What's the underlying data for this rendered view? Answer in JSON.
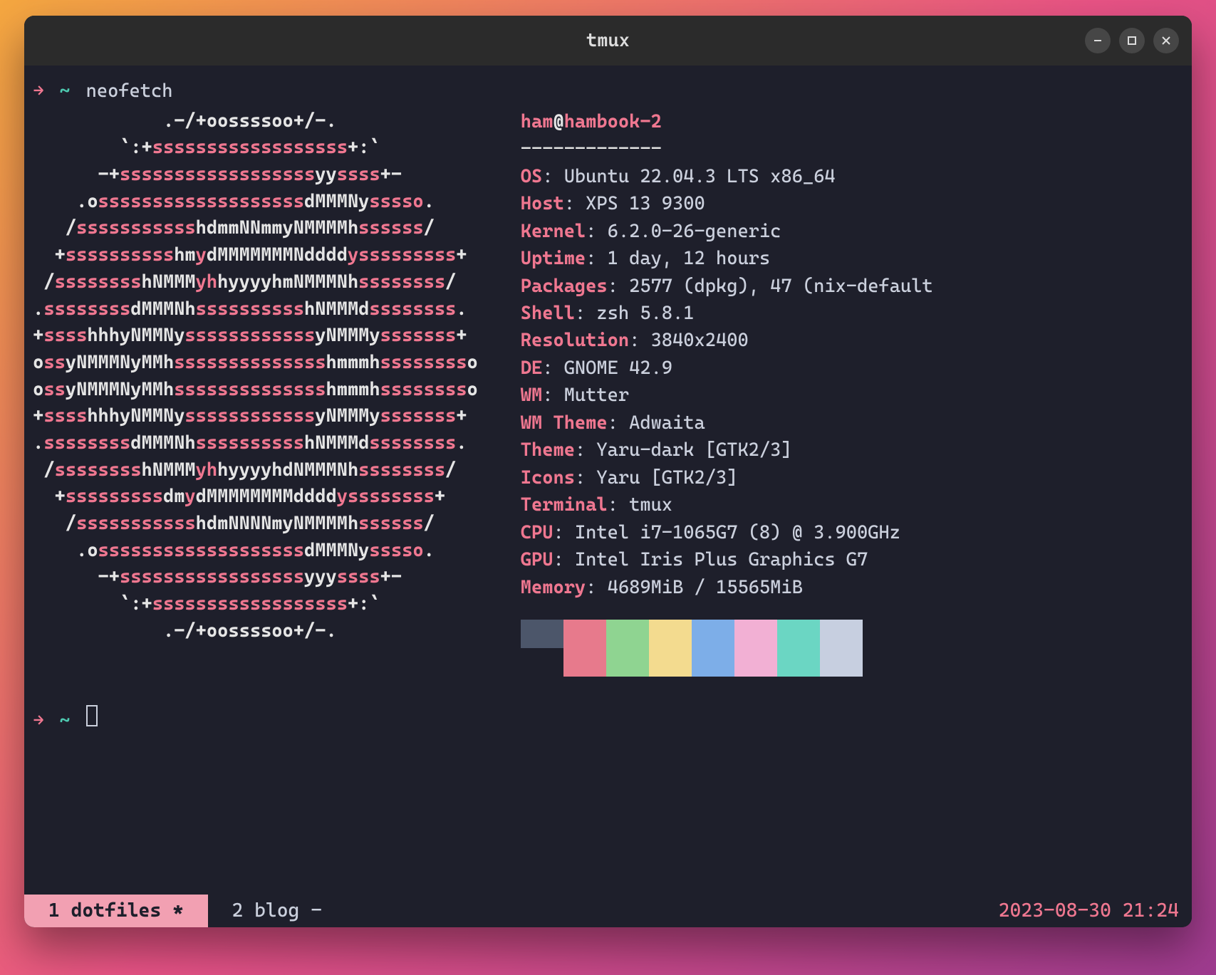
{
  "window": {
    "title": "tmux"
  },
  "prompt": {
    "arrow": "→",
    "tilde": "~",
    "command": "neofetch"
  },
  "ascii_art": [
    [
      [
        "w",
        "            .-/+oossssoo+/-."
      ]
    ],
    [
      [
        "w",
        "        `:+"
      ],
      [
        "p",
        "ssssssssssssssssss"
      ],
      [
        "w",
        "+:`"
      ]
    ],
    [
      [
        "w",
        "      -+"
      ],
      [
        "p",
        "ssssssssssssssssss"
      ],
      [
        "w",
        "yy"
      ],
      [
        "p",
        "ssss"
      ],
      [
        "w",
        "+-"
      ]
    ],
    [
      [
        "w",
        "    .o"
      ],
      [
        "p",
        "sssssssssssssssssss"
      ],
      [
        "w",
        "dMMMNy"
      ],
      [
        "p",
        "sssso"
      ],
      [
        "w",
        "."
      ]
    ],
    [
      [
        "w",
        "   /"
      ],
      [
        "p",
        "sssssssssss"
      ],
      [
        "w",
        "hdmmNNmmyNMMMMh"
      ],
      [
        "p",
        "ssssss"
      ],
      [
        "w",
        "/"
      ]
    ],
    [
      [
        "w",
        "  +"
      ],
      [
        "p",
        "ssssssssss"
      ],
      [
        "w",
        "hm"
      ],
      [
        "p",
        "y"
      ],
      [
        "w",
        "dMMMMMMMNdddd"
      ],
      [
        "p",
        "ysssssssss"
      ],
      [
        "w",
        "+"
      ]
    ],
    [
      [
        "w",
        " /"
      ],
      [
        "p",
        "ssssssss"
      ],
      [
        "w",
        "hNMMM"
      ],
      [
        "p",
        "yh"
      ],
      [
        "w",
        "hyyyyhmNMMMNh"
      ],
      [
        "p",
        "ssssssss"
      ],
      [
        "w",
        "/"
      ]
    ],
    [
      [
        "w",
        "."
      ],
      [
        "p",
        "ssssssss"
      ],
      [
        "w",
        "dMMMNh"
      ],
      [
        "p",
        "ssssssssss"
      ],
      [
        "w",
        "hNMMMd"
      ],
      [
        "p",
        "ssssssss"
      ],
      [
        "w",
        "."
      ]
    ],
    [
      [
        "w",
        "+"
      ],
      [
        "p",
        "ssss"
      ],
      [
        "w",
        "hhhyNMMNy"
      ],
      [
        "p",
        "ssssssssssss"
      ],
      [
        "w",
        "yNMMMy"
      ],
      [
        "p",
        "sssssss"
      ],
      [
        "w",
        "+"
      ]
    ],
    [
      [
        "w",
        "o"
      ],
      [
        "p",
        "ss"
      ],
      [
        "w",
        "yNMMMNyMMh"
      ],
      [
        "p",
        "ssssssssssssss"
      ],
      [
        "w",
        "hmmmh"
      ],
      [
        "p",
        "ssssssss"
      ],
      [
        "w",
        "o"
      ]
    ],
    [
      [
        "w",
        "o"
      ],
      [
        "p",
        "ss"
      ],
      [
        "w",
        "yNMMMNyMMh"
      ],
      [
        "p",
        "ssssssssssssss"
      ],
      [
        "w",
        "hmmmh"
      ],
      [
        "p",
        "ssssssss"
      ],
      [
        "w",
        "o"
      ]
    ],
    [
      [
        "w",
        "+"
      ],
      [
        "p",
        "ssss"
      ],
      [
        "w",
        "hhhyNMMNy"
      ],
      [
        "p",
        "ssssssssssss"
      ],
      [
        "w",
        "yNMMMy"
      ],
      [
        "p",
        "sssssss"
      ],
      [
        "w",
        "+"
      ]
    ],
    [
      [
        "w",
        "."
      ],
      [
        "p",
        "ssssssss"
      ],
      [
        "w",
        "dMMMNh"
      ],
      [
        "p",
        "ssssssssss"
      ],
      [
        "w",
        "hNMMMd"
      ],
      [
        "p",
        "ssssssss"
      ],
      [
        "w",
        "."
      ]
    ],
    [
      [
        "w",
        " /"
      ],
      [
        "p",
        "ssssssss"
      ],
      [
        "w",
        "hNMMM"
      ],
      [
        "p",
        "yh"
      ],
      [
        "w",
        "hyyyyhdNMMMNh"
      ],
      [
        "p",
        "ssssssss"
      ],
      [
        "w",
        "/"
      ]
    ],
    [
      [
        "w",
        "  +"
      ],
      [
        "p",
        "sssssssss"
      ],
      [
        "w",
        "dm"
      ],
      [
        "p",
        "y"
      ],
      [
        "w",
        "dMMMMMMMMdddd"
      ],
      [
        "p",
        "yssssssss"
      ],
      [
        "w",
        "+"
      ]
    ],
    [
      [
        "w",
        "   /"
      ],
      [
        "p",
        "sssssssssss"
      ],
      [
        "w",
        "hdmNNNNmyNMMMMh"
      ],
      [
        "p",
        "ssssss"
      ],
      [
        "w",
        "/"
      ]
    ],
    [
      [
        "w",
        "    .o"
      ],
      [
        "p",
        "sssssssssssssssssss"
      ],
      [
        "w",
        "dMMMNy"
      ],
      [
        "p",
        "sssso"
      ],
      [
        "w",
        "."
      ]
    ],
    [
      [
        "w",
        "      -+"
      ],
      [
        "p",
        "sssssssssssssssss"
      ],
      [
        "w",
        "yyy"
      ],
      [
        "p",
        "ssss"
      ],
      [
        "w",
        "+-"
      ]
    ],
    [
      [
        "w",
        "        `:+"
      ],
      [
        "p",
        "ssssssssssssssssss"
      ],
      [
        "w",
        "+:`"
      ]
    ],
    [
      [
        "w",
        "            .-/+oossssoo+/-."
      ]
    ]
  ],
  "neofetch": {
    "user": "ham",
    "at": "@",
    "hostname": "hambook-2",
    "dashline": "-------------",
    "rows": [
      {
        "key": "OS",
        "value": "Ubuntu 22.04.3 LTS x86_64"
      },
      {
        "key": "Host",
        "value": "XPS 13 9300"
      },
      {
        "key": "Kernel",
        "value": "6.2.0-26-generic"
      },
      {
        "key": "Uptime",
        "value": "1 day, 12 hours"
      },
      {
        "key": "Packages",
        "value": "2577 (dpkg), 47 (nix-default"
      },
      {
        "key": "Shell",
        "value": "zsh 5.8.1"
      },
      {
        "key": "Resolution",
        "value": "3840x2400"
      },
      {
        "key": "DE",
        "value": "GNOME 42.9"
      },
      {
        "key": "WM",
        "value": "Mutter"
      },
      {
        "key": "WM Theme",
        "value": "Adwaita"
      },
      {
        "key": "Theme",
        "value": "Yaru-dark [GTK2/3]"
      },
      {
        "key": "Icons",
        "value": "Yaru [GTK2/3]"
      },
      {
        "key": "Terminal",
        "value": "tmux"
      },
      {
        "key": "CPU",
        "value": "Intel i7-1065G7 (8) @ 3.900GHz"
      },
      {
        "key": "GPU",
        "value": "Intel Iris Plus Graphics G7"
      },
      {
        "key": "Memory",
        "value": "4689MiB / 15565MiB"
      }
    ]
  },
  "palette": {
    "row1": [
      "#3b4252",
      "#e77a8c",
      "#8fd491",
      "#f3db8f",
      "#7daee8",
      "#f2b0d4",
      "#6bd6c3",
      "#c7cfe0"
    ],
    "row2": [
      "#4c566a",
      "#e77a8c",
      "#8fd491",
      "#f3db8f",
      "#7daee8",
      "#f2b0d4",
      "#6bd6c3",
      "#c7cfe0"
    ]
  },
  "tmux": {
    "tabs": [
      {
        "index": "1",
        "name": "dotfiles",
        "flag": "*",
        "active": true
      },
      {
        "index": "2",
        "name": "blog",
        "flag": "-",
        "active": false
      }
    ],
    "clock": "2023-08-30 21:24"
  }
}
